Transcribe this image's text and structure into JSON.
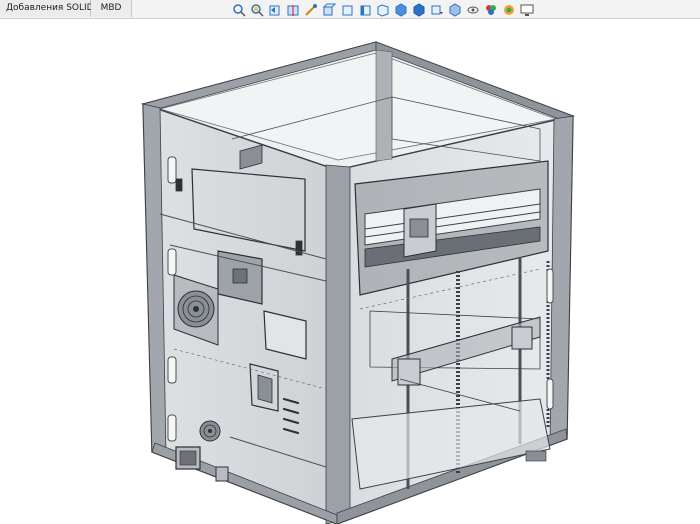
{
  "tabs": [
    {
      "label": "Добавления SOLIDWORKS"
    },
    {
      "label": "MBD"
    }
  ],
  "heads_up_toolbar": [
    {
      "icon": "zoom-to-fit-icon"
    },
    {
      "icon": "zoom-to-area-icon"
    },
    {
      "icon": "previous-view-icon"
    },
    {
      "icon": "section-view-icon"
    },
    {
      "icon": "dynamic-annotation-icon"
    },
    {
      "icon": "view-orientation-front-icon"
    },
    {
      "icon": "view-orientation-back-icon"
    },
    {
      "icon": "view-orientation-left-icon"
    },
    {
      "icon": "view-orientation-right-icon"
    },
    {
      "icon": "view-orientation-top-icon"
    },
    {
      "icon": "view-orientation-iso-icon"
    },
    {
      "icon": "view-orientation-dropdown-icon"
    },
    {
      "icon": "display-style-icon"
    },
    {
      "icon": "hide-show-items-icon"
    },
    {
      "icon": "edit-appearance-icon"
    },
    {
      "icon": "apply-scene-icon"
    },
    {
      "icon": "view-settings-icon"
    }
  ],
  "colors": {
    "accent_blue": "#2a73c9",
    "model_gray": "#8f949a",
    "model_dark": "#3c4045",
    "background": "#ffffff"
  }
}
